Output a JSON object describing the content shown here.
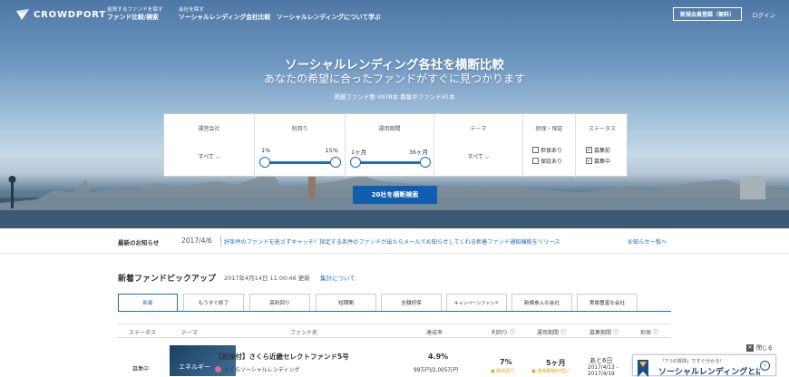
{
  "header": {
    "logo_text": "CROWDPORT",
    "nav": [
      {
        "small": "投資するファンドを探す",
        "label": "ファンド比較/検索"
      },
      {
        "small": "会社を探す",
        "label": "ソーシャルレンディング会社比較"
      },
      {
        "small": "",
        "label": "ソーシャルレンディングについて学ぶ"
      }
    ],
    "register_button": "新規会員登録（無料）",
    "login": "ログイン"
  },
  "hero": {
    "title": "ソーシャルレンディング各社を横断比較",
    "subtitle": "あなたの希望に合ったファンドがすぐに見つかります",
    "counts": "掲載ファンド数 4978本  募集中ファンド41本"
  },
  "search": {
    "company": {
      "header": "運営会社",
      "value": "すべて"
    },
    "rate": {
      "header": "利回り",
      "min": "1%",
      "max": "15%"
    },
    "period": {
      "header": "運用期間",
      "min": "1ヶ月",
      "max": "36ヶ月"
    },
    "theme": {
      "header": "テーマ",
      "value": "すべて"
    },
    "guarantee": {
      "header": "担保・保証",
      "options": [
        {
          "label": "担保あり",
          "checked": false
        },
        {
          "label": "保証あり",
          "checked": false
        }
      ]
    },
    "status": {
      "header": "ステータス",
      "options": [
        {
          "label": "募集前",
          "checked": true
        },
        {
          "label": "募集中",
          "checked": true
        }
      ]
    },
    "button": "20社を横断検索"
  },
  "news": {
    "label": "最新のお知らせ",
    "date": "2017/4/6",
    "text": "好条件のファンドを逃さずキャッチ！指定する条件のファンドが出たらメールでお知らせしてくれる新着ファンド通知機能をリリース",
    "more": "お知らせ一覧へ"
  },
  "pickup": {
    "title": "新着ファンドピックアップ",
    "updated": "2017年4月14日 11:00:46 更新",
    "link": "集計について",
    "tabs": [
      "新着",
      "もうすぐ終了",
      "高利回り",
      "短期間",
      "全額担保",
      "キャンペーンファンド",
      "新規参入の会社",
      "実績豊富な会社"
    ],
    "columns": [
      "ステータス",
      "テーマ",
      "ファンド名",
      "達成率",
      "利回り",
      "運用期間",
      "募集期間",
      "担保"
    ],
    "rows": [
      {
        "status": "募集中",
        "theme": "エネルギー",
        "name": "【担保付】さくら近畿セレクトファンド5号",
        "company": "さくらソーシャルレンディング",
        "rate_achieved": "4.9%",
        "amount": "99万円/2,005万円",
        "yield": "7%",
        "yield_badge": "● 高利回り",
        "period": "5ヶ月",
        "period_badge": "● 運用期間が短い",
        "remaining": "あと6日",
        "dates": [
          "2017/4/13 -",
          "2017/4/19"
        ]
      }
    ]
  },
  "popup": {
    "close_label": "閉じる",
    "small": "「7つの質問」ですぐ分かる！",
    "title": "ソーシャルレンディングとは？"
  }
}
